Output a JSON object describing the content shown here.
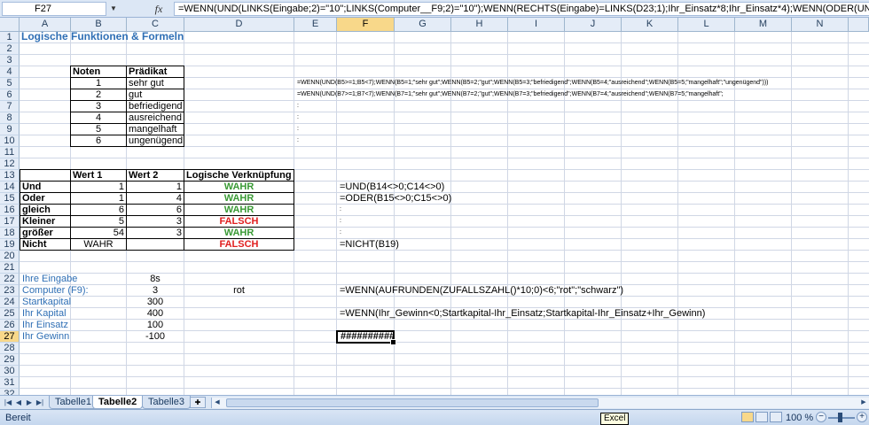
{
  "formula_bar": {
    "name_box": "F27",
    "fx_label": "fx",
    "formula": "=WENN(UND(LINKS(Eingabe;2)=\"10\";LINKS(Computer__F9;2)=\"10\");WENN(RECHTS(Eingabe)=LINKS(D23;1);Ihr_Einsatz*8;Ihr_Einsatz*4);WENN(ODER(UND(LINKS(Eingabe;2)"
  },
  "columns": [
    "A",
    "B",
    "C",
    "D",
    "E",
    "F",
    "G",
    "H",
    "I",
    "J",
    "K",
    "L",
    "M",
    "N"
  ],
  "selected_column": "F",
  "rows": [
    "1",
    "2",
    "3",
    "4",
    "5",
    "6",
    "7",
    "8",
    "9",
    "10",
    "11",
    "12",
    "13",
    "14",
    "15",
    "16",
    "17",
    "18",
    "19",
    "20",
    "21",
    "22",
    "23",
    "24",
    "25",
    "26",
    "27",
    "28",
    "29",
    "30",
    "31",
    "32"
  ],
  "selected_row": "27",
  "title": "Logische Funktionen & Formeln",
  "grades_table": {
    "header": [
      "Noten",
      "Prädikat"
    ],
    "rows": [
      {
        "note": "1",
        "praedikat": "sehr gut"
      },
      {
        "note": "2",
        "praedikat": "gut"
      },
      {
        "note": "3",
        "praedikat": "befriedigend"
      },
      {
        "note": "4",
        "praedikat": "ausreichend"
      },
      {
        "note": "5",
        "praedikat": "mangelhaft"
      },
      {
        "note": "6",
        "praedikat": "ungenügend"
      }
    ]
  },
  "grade_formulas": {
    "row5": "=WENN(UND(B5>=1;B5<7);WENN(B5=1;\"sehr gut\";WENN(B5=2;\"gut\";WENN(B5=3;\"befriedigend\";WENN(B5=4;\"ausreichend\";WENN(B5=5;\"mangelhaft\";\"ungenügend\")))",
    "row6": "=WENN(UND(B7>=1;B7<7);WENN(B7=1;\"sehr gut\";WENN(B7=2;\"gut\";WENN(B7=3;\"befriedigend\";WENN(B7=4;\"ausreichend\";WENN(B7=5;\"mangelhaft\";",
    "row7": ":",
    "row8": ":",
    "row9": ":",
    "row10": ":"
  },
  "logic_table": {
    "header": [
      "Wert 1",
      "Wert 2",
      "Logische Verknüpfung"
    ],
    "rows": [
      {
        "label": "Und",
        "w1": "1",
        "w2": "1",
        "result": "WAHR",
        "formula": "=UND(B14<>0;C14<>0)"
      },
      {
        "label": "Oder",
        "w1": "1",
        "w2": "4",
        "result": "WAHR",
        "formula": "=ODER(B15<>0;C15<>0)"
      },
      {
        "label": "gleich",
        "w1": "6",
        "w2": "6",
        "result": "WAHR",
        "formula": ":"
      },
      {
        "label": "Kleiner",
        "w1": "5",
        "w2": "3",
        "result": "FALSCH",
        "formula": ":"
      },
      {
        "label": "größer",
        "w1": "54",
        "w2": "3",
        "result": "WAHR",
        "formula": ":"
      },
      {
        "label": "Nicht",
        "w1": "WAHR",
        "w2": "",
        "result": "FALSCH",
        "formula": "=NICHT(B19)"
      }
    ]
  },
  "game": {
    "eingabe_label": "Ihre Eingabe",
    "eingabe_value": "8s",
    "computer_label": "Computer (F9):",
    "computer_value": "3",
    "computer_color": "rot",
    "computer_formula": "=WENN(AUFRUNDEN(ZUFALLSZAHL()*10;0)<6;\"rot\";\"schwarz\")",
    "startkapital_label": "Startkapital",
    "startkapital_value": "300",
    "kapital_label": "Ihr Kapital",
    "kapital_value": "400",
    "kapital_formula": "=WENN(Ihr_Gewinn<0;Startkapital-Ihr_Einsatz;Startkapital-Ihr_Einsatz+Ihr_Gewinn)",
    "einsatz_label": "Ihr Einsatz",
    "einsatz_value": "100",
    "gewinn_label": "Ihr Gewinn",
    "gewinn_value": "-100",
    "f27_value": "##########"
  },
  "sheet_tabs": [
    "Tabelle1",
    "Tabelle2",
    "Tabelle3"
  ],
  "active_tab": "Tabelle2",
  "status": {
    "text": "Bereit",
    "zoom": "100 %",
    "tooltip": "Excel"
  },
  "colors": {
    "title_blue": "#2f6fb5",
    "true_green": "#3a9a35",
    "false_red": "#e02020",
    "selection_header": "#f8d88a"
  }
}
